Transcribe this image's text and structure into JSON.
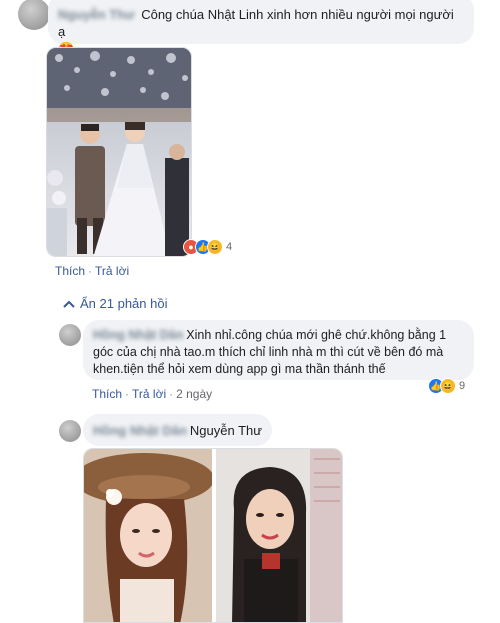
{
  "comment1": {
    "author": "Nguyễn Thư",
    "text": "Công chúa Nhật Linh xinh hơn nhiều người mọi người ạ",
    "emoji": "😍",
    "reaction_count": "4",
    "reactions": [
      "angry",
      "like",
      "haha"
    ],
    "like_label": "Thích",
    "reply_label": "Trả lời"
  },
  "replies_toggle": {
    "label": "Ẩn 21 phản hồi",
    "icon": "chevron-up-icon"
  },
  "reply1": {
    "author": "Hồng Nhật Dân",
    "text": "Xinh nhỉ.công chúa mới ghê chứ.không bằng 1 góc của chị nhà tao.m thích chỉ linh nhà m thì cút về bên đó mà khen.tiện thể hỏi xem dùng app gì ma thần thánh thế",
    "reaction_count": "9",
    "reactions": [
      "like",
      "haha"
    ],
    "like_label": "Thích",
    "reply_label": "Trả lời",
    "time": "2 ngày"
  },
  "reply2": {
    "author": "Hồng Nhật Dân",
    "mention": "Nguyễn Thư"
  },
  "colors": {
    "link": "#385898",
    "bubble": "#f0f2f5",
    "muted": "#65676b"
  }
}
